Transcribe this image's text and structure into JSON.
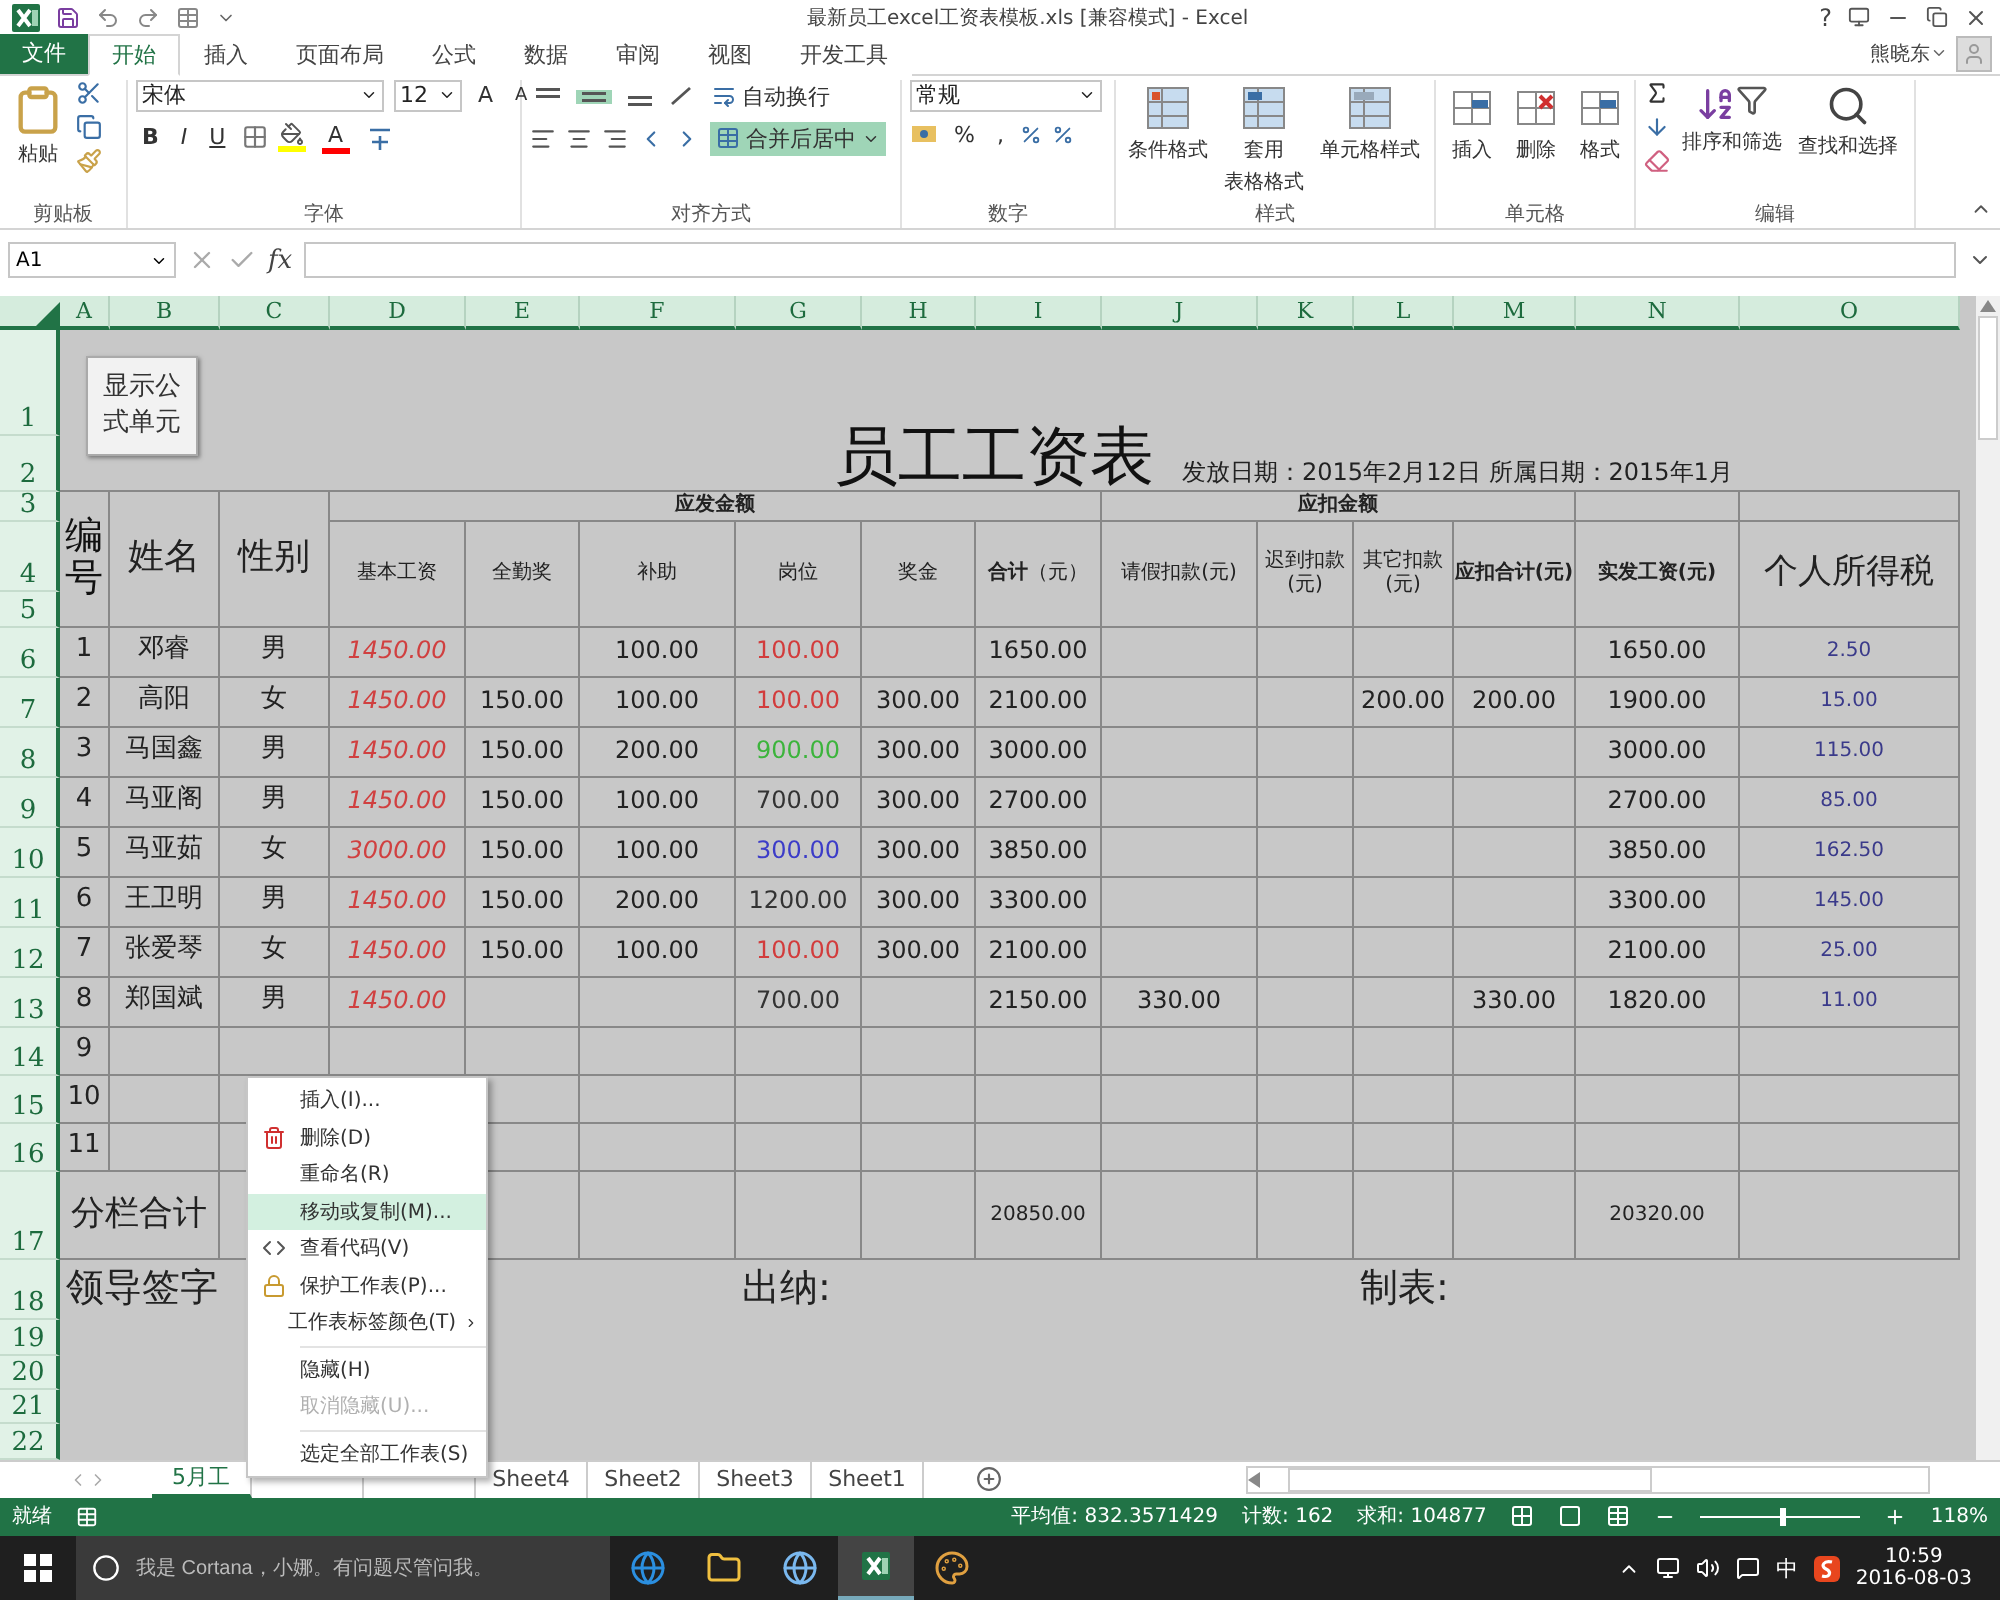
{
  "window": {
    "title": "最新员工excel工资表模板.xls  [兼容模式] - Excel",
    "help": "?"
  },
  "file_tab": "文件",
  "tabs": [
    {
      "label": "开始",
      "selected": true
    },
    {
      "label": "插入",
      "selected": false
    },
    {
      "label": "页面布局",
      "selected": false
    },
    {
      "label": "公式",
      "selected": false
    },
    {
      "label": "数据",
      "selected": false
    },
    {
      "label": "审阅",
      "selected": false
    },
    {
      "label": "视图",
      "selected": false
    },
    {
      "label": "开发工具",
      "selected": false
    }
  ],
  "user": {
    "name": "熊晓东"
  },
  "clipboard": {
    "label": "剪贴板",
    "paste": "粘贴"
  },
  "font": {
    "label": "字体",
    "name": "宋体",
    "size": "12",
    "grow": "A",
    "shrink": "A",
    "bold": "B",
    "italic": "I",
    "underline": "U",
    "color_letter": "A"
  },
  "alignment": {
    "label": "对齐方式",
    "vertical": [
      {
        "selected": false
      },
      {
        "selected": true
      },
      {
        "selected": false
      }
    ],
    "wrap": "自动换行",
    "merge": {
      "label": "合并后居中",
      "selected": true
    }
  },
  "number": {
    "label": "数字",
    "format": "常规",
    "percent": "%",
    "comma": ","
  },
  "styles": {
    "label": "样式",
    "buttons": [
      {
        "lines": [
          "条件格式"
        ]
      },
      {
        "lines": [
          "套用",
          "表格格式"
        ]
      },
      {
        "lines": [
          "单元格样式"
        ]
      }
    ]
  },
  "cells": {
    "label": "单元格",
    "buttons": [
      "插入",
      "删除",
      "格式"
    ]
  },
  "editing": {
    "label": "编辑",
    "buttons": [
      "排序和筛选",
      "查找和选择"
    ]
  },
  "formula_bar": {
    "name_box": "A1",
    "fx": "fx"
  },
  "columns": [
    "A",
    "B",
    "C",
    "D",
    "E",
    "F",
    "G",
    "H",
    "I",
    "J",
    "K",
    "L",
    "M",
    "N",
    "O"
  ],
  "row_numbers": [
    "1",
    "2",
    "3",
    "4",
    "5",
    "6",
    "7",
    "8",
    "9",
    "10",
    "11",
    "12",
    "13",
    "14",
    "15",
    "16",
    "17",
    "18",
    "19",
    "20",
    "21",
    "22"
  ],
  "sheet": {
    "formula_button": "显示公式单元",
    "title": "员工工资表",
    "issue_info": "发放日期：2015年2月12日 所属日期：2015年1月",
    "headers": {
      "no": "编号",
      "name": "姓名",
      "gender": "性别",
      "earnings_group": "应发金额",
      "deductions_group": "应扣金额",
      "earnings": [
        "基本工资",
        "全勤奖",
        "补助",
        "岗位",
        "奖金"
      ],
      "total": "**合计**（元）",
      "deductions": [
        "请假扣款(元)",
        "迟到扣款(元)",
        "其它扣款(元)"
      ],
      "deduct_total": "应扣合计(元)",
      "net": "实发工资(元)",
      "tax": "个人所得税"
    },
    "employees": [
      {
        "no": "1",
        "name": "邓睿",
        "gender": "男",
        "base": "1450.00",
        "allowance": "100.00",
        "post": {
          "text": "100.00",
          "color": "#d23c3c"
        },
        "total": "1650.00",
        "net": "1650.00",
        "tax": "2.50"
      },
      {
        "no": "2",
        "name": "高阳",
        "gender": "女",
        "base": "1450.00",
        "attendance": "150.00",
        "allowance": "100.00",
        "post": {
          "text": "100.00",
          "color": "#d23c3c"
        },
        "bonus": "300.00",
        "total": "2100.00",
        "other": "200.00",
        "deduct_total": "200.00",
        "net": "1900.00",
        "tax": "15.00"
      },
      {
        "no": "3",
        "name": "马国鑫",
        "gender": "男",
        "base": "1450.00",
        "attendance": "150.00",
        "allowance": "200.00",
        "post": {
          "text": "900.00",
          "color": "#3cb43c"
        },
        "bonus": "300.00",
        "total": "3000.00",
        "net": "3000.00",
        "tax": "115.00"
      },
      {
        "no": "4",
        "name": "马亚阁",
        "gender": "男",
        "base": "1450.00",
        "attendance": "150.00",
        "allowance": "100.00",
        "post": {
          "text": "700.00",
          "color": "#333333"
        },
        "bonus": "300.00",
        "total": "2700.00",
        "net": "2700.00",
        "tax": "85.00"
      },
      {
        "no": "5",
        "name": "马亚茹",
        "gender": "女",
        "base": "3000.00",
        "attendance": "150.00",
        "allowance": "100.00",
        "post": {
          "text": "300.00",
          "color": "#3c3cc8"
        },
        "bonus": "300.00",
        "total": "3850.00",
        "net": "3850.00",
        "tax": "162.50"
      },
      {
        "no": "6",
        "name": "王卫明",
        "gender": "男",
        "base": "1450.00",
        "attendance": "150.00",
        "allowance": "200.00",
        "post": {
          "text": "1200.00",
          "color": "#333333"
        },
        "bonus": "300.00",
        "total": "3300.00",
        "net": "3300.00",
        "tax": "145.00"
      },
      {
        "no": "7",
        "name": "张爱琴",
        "gender": "女",
        "base": "1450.00",
        "attendance": "150.00",
        "allowance": "100.00",
        "post": {
          "text": "100.00",
          "color": "#d23c3c"
        },
        "bonus": "300.00",
        "total": "2100.00",
        "net": "2100.00",
        "tax": "25.00"
      },
      {
        "no": "8",
        "name": "郑国斌",
        "gender": "男",
        "base": "1450.00",
        "post": {
          "text": "700.00",
          "color": "#333333"
        },
        "total": "2150.00",
        "leave": "330.00",
        "deduct_total": "330.00",
        "net": "1820.00",
        "tax": "11.00"
      }
    ],
    "empty_rows": [
      "9",
      "10",
      "11"
    ],
    "subtotal": {
      "label": "分栏合计",
      "total": "20850.00",
      "net": "20320.00"
    },
    "signatures": [
      "领导签字",
      "出纳:",
      "制表:"
    ]
  },
  "context_menu": [
    {
      "label": "插入(I)...",
      "kind": "plain",
      "selected": false,
      "disabled": false
    },
    {
      "label": "删除(D)",
      "kind": "delete",
      "selected": false,
      "disabled": false
    },
    {
      "label": "重命名(R)",
      "kind": "plain",
      "selected": false,
      "disabled": false
    },
    {
      "label": "移动或复制(M)...",
      "kind": "plain",
      "selected": true,
      "disabled": false
    },
    {
      "label": "查看代码(V)",
      "kind": "code",
      "selected": false,
      "disabled": false
    },
    {
      "label": "保护工作表(P)...",
      "kind": "protect",
      "selected": false,
      "disabled": false
    },
    {
      "label": "工作表标签颜色(T)",
      "kind": "submenu",
      "selected": false,
      "disabled": false
    },
    {
      "kind": "separator"
    },
    {
      "label": "隐藏(H)",
      "kind": "plain",
      "selected": false,
      "disabled": false
    },
    {
      "label": "取消隐藏(U)...",
      "kind": "plain",
      "selected": false,
      "disabled": true
    },
    {
      "kind": "separator"
    },
    {
      "label": "选定全部工作表(S)",
      "kind": "plain",
      "selected": false,
      "disabled": false
    }
  ],
  "sheet_tabs": [
    {
      "label": "5月工",
      "selected": true
    },
    {
      "selected": false
    },
    {
      "selected": false
    },
    {
      "label": "Sheet4",
      "selected": false
    },
    {
      "label": "Sheet2",
      "selected": false
    },
    {
      "label": "Sheet3",
      "selected": false
    },
    {
      "label": "Sheet1",
      "selected": false
    }
  ],
  "status_bar": {
    "ready": "就绪",
    "stats": [
      "平均值: 832.3571429",
      "计数: 162",
      "求和: 104877"
    ],
    "zoom_slider": {
      "level": 0.5
    },
    "zoom": "118%"
  },
  "taskbar": {
    "search_placeholder": "我是 Cortana，小娜。有问题尽管问我。",
    "ime": "中",
    "time": "10:59",
    "date": "2016-08-03"
  }
}
